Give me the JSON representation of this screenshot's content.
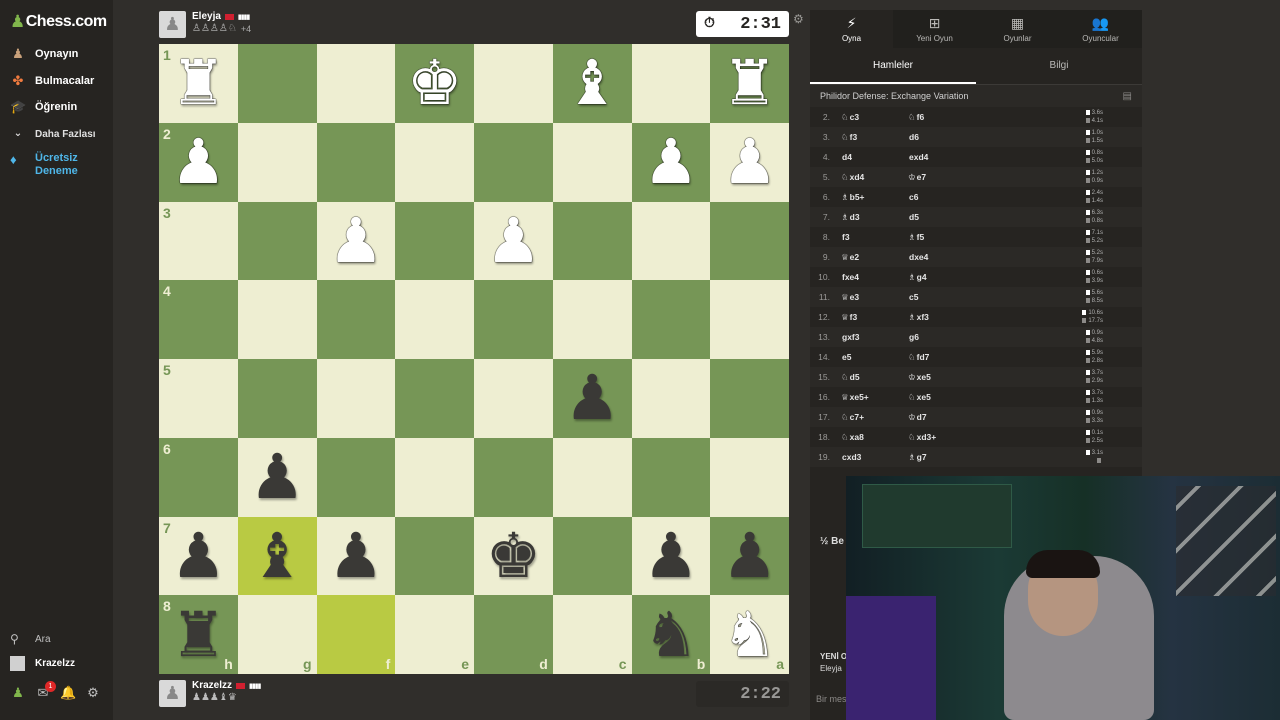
{
  "sidebar": {
    "logo": "Chess.com",
    "nav": [
      {
        "label": "Oynayın",
        "icon": "pawn-play-icon"
      },
      {
        "label": "Bulmacalar",
        "icon": "puzzle-icon"
      },
      {
        "label": "Öğrenin",
        "icon": "learn-icon"
      },
      {
        "label": "Daha Fazlası",
        "icon": "chevron-down-icon"
      }
    ],
    "trial_line1": "Ücretsiz",
    "trial_line2": "Deneme",
    "search_label": "Ara",
    "username": "Krazelzz",
    "notification_count": "1"
  },
  "top_player": {
    "name": "Eleyja",
    "rating_bars": "▮▮▮▮",
    "captured": "♙♙♙♙♘",
    "material_diff": "+4",
    "clock": "2:31"
  },
  "bottom_player": {
    "name": "Krazelzz",
    "rating_bars": "▮▮▮▮",
    "captured": "♟♟♟♝♛",
    "clock": "2:22"
  },
  "board": {
    "ranks": [
      "1",
      "2",
      "3",
      "4",
      "5",
      "6",
      "7",
      "8"
    ],
    "files": [
      "h",
      "g",
      "f",
      "e",
      "d",
      "c",
      "b",
      "a"
    ],
    "position": [
      [
        "R",
        "",
        "",
        "K",
        "",
        "B",
        "",
        "R"
      ],
      [
        "P",
        "",
        "",
        "",
        "",
        "",
        "P",
        "P"
      ],
      [
        "",
        "",
        "P",
        "",
        "P",
        "",
        "",
        ""
      ],
      [
        "",
        "",
        "",
        "",
        "",
        "",
        "",
        ""
      ],
      [
        "",
        "",
        "",
        "",
        "",
        "p",
        "",
        ""
      ],
      [
        "",
        "p",
        "",
        "",
        "",
        "",
        "",
        ""
      ],
      [
        "p",
        "b",
        "p",
        "",
        "k",
        "",
        "p",
        "p"
      ],
      [
        "r",
        "",
        "",
        "",
        "",
        "",
        "n",
        "N"
      ]
    ],
    "highlighted": [
      "g7",
      "f8"
    ]
  },
  "panel": {
    "top_tabs": [
      {
        "label": "Oyna",
        "icon": "bolt-icon"
      },
      {
        "label": "Yeni Oyun",
        "icon": "plus-icon"
      },
      {
        "label": "Oyunlar",
        "icon": "board-icon"
      },
      {
        "label": "Oyuncular",
        "icon": "players-icon"
      }
    ],
    "sub_tabs": [
      "Hamleler",
      "Bilgi"
    ],
    "opening": "Philidor Defense: Exchange Variation",
    "draw_label": "½ Be",
    "new_game_line1": "YENİ O",
    "new_game_line2": "Eleyja",
    "chat_placeholder": "Bir mes"
  },
  "moves": [
    {
      "n": "2.",
      "wp": "♘",
      "w": "c3",
      "bp": "♘",
      "b": "f6",
      "tw": "3.6s",
      "tb": "4.1s"
    },
    {
      "n": "3.",
      "wp": "♘",
      "w": "f3",
      "bp": "",
      "b": "d6",
      "tw": "1.0s",
      "tb": "1.5s"
    },
    {
      "n": "4.",
      "wp": "",
      "w": "d4",
      "bp": "",
      "b": "exd4",
      "tw": "0.8s",
      "tb": "5.0s"
    },
    {
      "n": "5.",
      "wp": "♘",
      "w": "xd4",
      "bp": "♔",
      "b": "e7",
      "tw": "1.2s",
      "tb": "0.9s"
    },
    {
      "n": "6.",
      "wp": "♗",
      "w": "b5+",
      "bp": "",
      "b": "c6",
      "tw": "2.4s",
      "tb": "1.4s"
    },
    {
      "n": "7.",
      "wp": "♗",
      "w": "d3",
      "bp": "",
      "b": "d5",
      "tw": "6.3s",
      "tb": "0.8s"
    },
    {
      "n": "8.",
      "wp": "",
      "w": "f3",
      "bp": "♗",
      "b": "f5",
      "tw": "7.1s",
      "tb": "5.2s"
    },
    {
      "n": "9.",
      "wp": "♕",
      "w": "e2",
      "bp": "",
      "b": "dxe4",
      "tw": "5.2s",
      "tb": "7.9s"
    },
    {
      "n": "10.",
      "wp": "",
      "w": "fxe4",
      "bp": "♗",
      "b": "g4",
      "tw": "0.6s",
      "tb": "3.9s"
    },
    {
      "n": "11.",
      "wp": "♕",
      "w": "e3",
      "bp": "",
      "b": "c5",
      "tw": "5.6s",
      "tb": "8.5s"
    },
    {
      "n": "12.",
      "wp": "♕",
      "w": "f3",
      "bp": "♗",
      "b": "xf3",
      "tw": "10.6s",
      "tb": "17.7s"
    },
    {
      "n": "13.",
      "wp": "",
      "w": "gxf3",
      "bp": "",
      "b": "g6",
      "tw": "0.9s",
      "tb": "4.8s"
    },
    {
      "n": "14.",
      "wp": "",
      "w": "e5",
      "bp": "♘",
      "b": "fd7",
      "tw": "5.9s",
      "tb": "2.8s"
    },
    {
      "n": "15.",
      "wp": "♘",
      "w": "d5",
      "bp": "♔",
      "b": "xe5",
      "tw": "3.7s",
      "tb": "2.9s"
    },
    {
      "n": "16.",
      "wp": "♕",
      "w": "xe5+",
      "bp": "♘",
      "b": "xe5",
      "tw": "3.7s",
      "tb": "1.3s"
    },
    {
      "n": "17.",
      "wp": "♘",
      "w": "c7+",
      "bp": "♔",
      "b": "d7",
      "tw": "0.9s",
      "tb": "3.3s"
    },
    {
      "n": "18.",
      "wp": "♘",
      "w": "xa8",
      "bp": "♘",
      "b": "xd3+",
      "tw": "0.1s",
      "tb": "2.5s"
    },
    {
      "n": "19.",
      "wp": "",
      "w": "cxd3",
      "bp": "♗",
      "b": "g7",
      "tw": "3.1s",
      "tb": ""
    }
  ]
}
